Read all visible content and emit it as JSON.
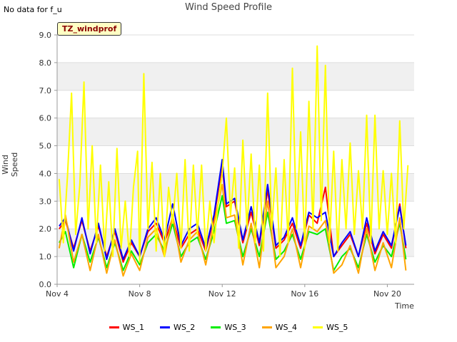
{
  "header": {
    "nodata_text": "No data for f_u",
    "title": "Wind Speed Profile"
  },
  "site_label": "TZ_windprof",
  "chart_data": {
    "type": "line",
    "title": "Wind Speed Profile",
    "xlabel": "Time",
    "ylabel": "Wind Speed",
    "xlim": [
      0,
      17.3
    ],
    "ylim": [
      0,
      9.0
    ],
    "x_ticks": [
      {
        "x": 0,
        "label": "Nov 4"
      },
      {
        "x": 4,
        "label": "Nov 8"
      },
      {
        "x": 8,
        "label": "Nov 12"
      },
      {
        "x": 12,
        "label": "Nov 16"
      },
      {
        "x": 16,
        "label": "Nov 20"
      }
    ],
    "y_ticks": [
      0.0,
      1.0,
      2.0,
      3.0,
      4.0,
      5.0,
      6.0,
      7.0,
      8.0,
      9.0
    ],
    "y_tick_labels": [
      "0.0",
      "1.0",
      "2.0",
      "3.0",
      "4.0",
      "5.0",
      "6.0",
      "7.0",
      "8.0",
      "9.0"
    ],
    "grid": true,
    "background_bands": "alternating light gray",
    "legend_placement": "bottom-center",
    "series": [
      {
        "name": "WS_1",
        "color": "#ff0000",
        "x": [
          0.1,
          0.4,
          0.8,
          1.2,
          1.6,
          2.0,
          2.4,
          2.8,
          3.2,
          3.6,
          4.0,
          4.4,
          4.8,
          5.2,
          5.6,
          6.0,
          6.4,
          6.8,
          7.2,
          7.6,
          8.0,
          8.2,
          8.6,
          9.0,
          9.4,
          9.8,
          10.2,
          10.6,
          11.0,
          11.4,
          11.8,
          12.2,
          12.6,
          13.0,
          13.4,
          13.8,
          14.2,
          14.6,
          15.0,
          15.4,
          15.8,
          16.2,
          16.6,
          16.9
        ],
        "y": [
          2.0,
          2.3,
          1.3,
          2.3,
          1.2,
          2.1,
          1.0,
          1.9,
          0.8,
          1.5,
          1.0,
          1.9,
          2.2,
          1.5,
          2.4,
          1.3,
          1.8,
          2.0,
          1.2,
          2.4,
          4.3,
          2.8,
          3.0,
          1.5,
          2.6,
          1.4,
          3.4,
          1.3,
          1.6,
          2.2,
          1.3,
          2.5,
          2.2,
          3.5,
          1.0,
          1.4,
          1.8,
          1.0,
          2.2,
          1.1,
          1.8,
          1.3,
          2.9,
          1.3
        ]
      },
      {
        "name": "WS_2",
        "color": "#0000ff",
        "x": [
          0.1,
          0.4,
          0.8,
          1.2,
          1.6,
          2.0,
          2.4,
          2.8,
          3.2,
          3.6,
          4.0,
          4.4,
          4.8,
          5.2,
          5.6,
          6.0,
          6.4,
          6.8,
          7.2,
          7.6,
          8.0,
          8.2,
          8.6,
          9.0,
          9.4,
          9.8,
          10.2,
          10.6,
          11.0,
          11.4,
          11.8,
          12.2,
          12.6,
          13.0,
          13.4,
          13.8,
          14.2,
          14.6,
          15.0,
          15.4,
          15.8,
          16.2,
          16.6,
          16.9
        ],
        "y": [
          2.1,
          2.4,
          1.2,
          2.4,
          1.1,
          2.2,
          0.9,
          2.0,
          0.9,
          1.6,
          1.0,
          2.0,
          2.4,
          1.6,
          2.9,
          1.4,
          2.0,
          2.2,
          1.3,
          2.5,
          4.5,
          2.9,
          3.1,
          1.6,
          2.8,
          1.5,
          3.6,
          1.4,
          1.7,
          2.4,
          1.4,
          2.6,
          2.4,
          2.6,
          1.0,
          1.5,
          1.9,
          1.0,
          2.4,
          1.2,
          1.9,
          1.4,
          2.8,
          1.4
        ]
      },
      {
        "name": "WS_3",
        "color": "#00ee00",
        "x": [
          0.1,
          0.4,
          0.8,
          1.2,
          1.6,
          2.0,
          2.4,
          2.8,
          3.2,
          3.6,
          4.0,
          4.4,
          4.8,
          5.2,
          5.6,
          6.0,
          6.4,
          6.8,
          7.2,
          7.6,
          8.0,
          8.2,
          8.6,
          9.0,
          9.4,
          9.8,
          10.2,
          10.6,
          11.0,
          11.4,
          11.8,
          12.2,
          12.6,
          13.0,
          13.4,
          13.8,
          14.2,
          14.6,
          15.0,
          15.4,
          15.8,
          16.2,
          16.6,
          16.9
        ],
        "y": [
          1.5,
          1.9,
          0.6,
          1.8,
          0.8,
          1.7,
          0.6,
          1.5,
          0.5,
          1.2,
          0.7,
          1.5,
          1.8,
          1.2,
          2.2,
          1.0,
          1.5,
          1.7,
          0.9,
          1.9,
          3.2,
          2.2,
          2.3,
          1.0,
          2.0,
          1.0,
          2.6,
          0.9,
          1.2,
          1.8,
          0.9,
          1.9,
          1.8,
          2.0,
          0.5,
          1.0,
          1.3,
          0.6,
          1.8,
          0.8,
          1.4,
          1.0,
          2.2,
          0.9
        ]
      },
      {
        "name": "WS_4",
        "color": "#ffa500",
        "x": [
          0.1,
          0.4,
          0.8,
          1.2,
          1.6,
          2.0,
          2.4,
          2.8,
          3.2,
          3.6,
          4.0,
          4.4,
          4.8,
          5.2,
          5.6,
          6.0,
          6.4,
          6.8,
          7.2,
          7.6,
          8.0,
          8.2,
          8.6,
          9.0,
          9.4,
          9.8,
          10.2,
          10.6,
          11.0,
          11.4,
          11.8,
          12.2,
          12.6,
          13.0,
          13.4,
          13.8,
          14.2,
          14.6,
          15.0,
          15.4,
          15.8,
          16.2,
          16.6,
          16.9
        ],
        "y": [
          1.3,
          2.5,
          0.8,
          1.8,
          0.5,
          1.8,
          0.4,
          1.6,
          0.3,
          1.1,
          0.5,
          1.7,
          2.0,
          1.0,
          2.5,
          0.8,
          1.6,
          1.9,
          0.7,
          2.2,
          3.6,
          2.4,
          2.5,
          0.7,
          2.2,
          0.6,
          3.0,
          0.6,
          1.0,
          2.0,
          0.6,
          2.1,
          1.9,
          2.3,
          0.4,
          0.7,
          1.4,
          0.4,
          2.0,
          0.5,
          1.5,
          0.6,
          2.4,
          0.5
        ]
      },
      {
        "name": "WS_5",
        "color": "#ffff00",
        "x": [
          0.1,
          0.3,
          0.5,
          0.7,
          0.9,
          1.1,
          1.3,
          1.5,
          1.7,
          1.9,
          2.1,
          2.3,
          2.5,
          2.7,
          2.9,
          3.1,
          3.3,
          3.5,
          3.7,
          3.9,
          4.0,
          4.2,
          4.4,
          4.6,
          4.8,
          5.0,
          5.2,
          5.4,
          5.6,
          5.8,
          6.0,
          6.2,
          6.4,
          6.6,
          6.8,
          7.0,
          7.2,
          7.4,
          7.6,
          7.8,
          8.0,
          8.2,
          8.4,
          8.6,
          8.8,
          9.0,
          9.2,
          9.4,
          9.6,
          9.8,
          10.0,
          10.2,
          10.4,
          10.6,
          10.8,
          11.0,
          11.2,
          11.4,
          11.6,
          11.8,
          12.0,
          12.2,
          12.4,
          12.6,
          12.8,
          13.0,
          13.2,
          13.4,
          13.6,
          13.8,
          14.0,
          14.2,
          14.4,
          14.6,
          14.8,
          15.0,
          15.2,
          15.4,
          15.6,
          15.8,
          16.0,
          16.2,
          16.4,
          16.6,
          16.8,
          17.0
        ],
        "y": [
          3.8,
          1.5,
          3.9,
          6.9,
          1.8,
          3.6,
          7.3,
          2.0,
          5.0,
          1.5,
          4.3,
          1.2,
          3.7,
          1.0,
          4.9,
          1.3,
          3.0,
          1.0,
          3.5,
          4.8,
          0.8,
          7.6,
          2.0,
          4.4,
          1.2,
          4.0,
          1.0,
          3.5,
          2.2,
          4.0,
          1.3,
          4.5,
          1.2,
          4.3,
          1.8,
          4.3,
          1.2,
          3.0,
          1.5,
          2.9,
          4.0,
          6.0,
          2.5,
          4.2,
          1.3,
          5.2,
          2.0,
          4.7,
          1.5,
          4.3,
          1.2,
          6.9,
          2.0,
          4.2,
          1.0,
          4.5,
          1.5,
          7.8,
          2.0,
          5.5,
          1.3,
          6.6,
          2.0,
          8.6,
          2.3,
          7.9,
          1.5,
          4.8,
          1.2,
          4.5,
          2.0,
          5.1,
          1.8,
          4.1,
          2.0,
          6.1,
          1.5,
          6.1,
          2.0,
          4.1,
          1.8,
          4.0,
          1.5,
          5.9,
          2.0,
          4.3
        ]
      }
    ]
  }
}
